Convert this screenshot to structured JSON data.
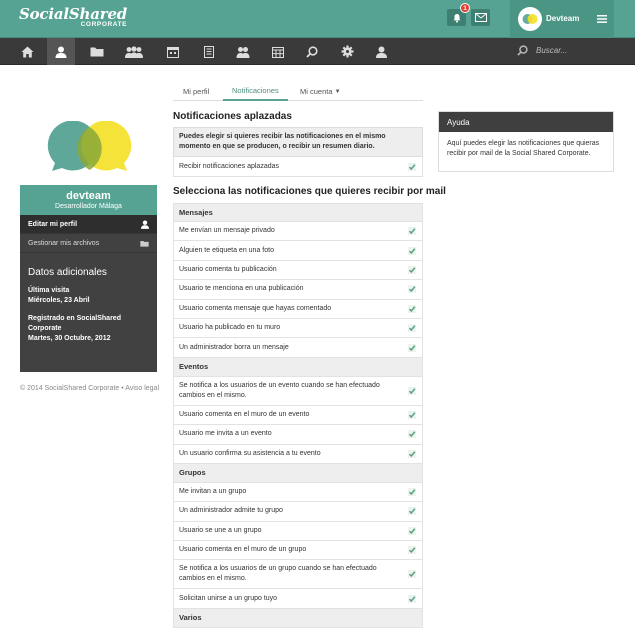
{
  "header": {
    "logo_main": "SocialShared",
    "logo_sub": "CORPORATE",
    "notification_count": "1",
    "user_name": "Devteam"
  },
  "nav": {
    "search_placeholder": "Buscar..."
  },
  "tabs": [
    {
      "label": "Mi perfil"
    },
    {
      "label": "Notificaciones"
    },
    {
      "label": "Mi cuenta"
    }
  ],
  "profile": {
    "name": "devteam",
    "role": "Desarrollador Málaga",
    "menu": [
      {
        "label": "Editar mi perfil"
      },
      {
        "label": "Gestionar mis archivos"
      }
    ],
    "section_title": "Datos adicionales",
    "last_visit_label": "Última visita",
    "last_visit_value": "Miércoles, 23 Abril",
    "registered_label": "Registrado en SocialShared Corporate",
    "registered_value": "Martes, 30 Octubre, 2012"
  },
  "footer": {
    "text": "© 2014 SocialShared Corporate • Aviso legal"
  },
  "deferred": {
    "title": "Notificaciones aplazadas",
    "info": "Puedes elegir si quieres recibir las notificaciones en el mismo momento en que se producen, o recibir un resumen diario.",
    "option": "Recibir notificaciones aplazadas"
  },
  "email": {
    "title": "Selecciona las notificaciones que quieres recibir por mail",
    "rows": [
      {
        "text": "Mensajes",
        "header": true
      },
      {
        "text": "Me envían un mensaje privado"
      },
      {
        "text": "Alguien te etiqueta en una foto"
      },
      {
        "text": "Usuario comenta tu publicación"
      },
      {
        "text": "Usuario te menciona en una publicación"
      },
      {
        "text": "Usuario comenta mensaje que hayas comentado"
      },
      {
        "text": "Usuario ha publicado en tu muro"
      },
      {
        "text": "Un administrador borra un mensaje"
      },
      {
        "text": "Eventos",
        "header": true
      },
      {
        "text": "Se notifica a los usuarios de un evento cuando se han efectuado cambios en el mismo.",
        "tall": true
      },
      {
        "text": "Usuario comenta en el muro de un evento"
      },
      {
        "text": "Usuario me invita a un evento"
      },
      {
        "text": "Un usuario confirma su asistencia a tu evento"
      },
      {
        "text": "Grupos",
        "header": true
      },
      {
        "text": "Me invitan a un grupo"
      },
      {
        "text": "Un administrador admite tu grupo"
      },
      {
        "text": "Usuario se une a un grupo"
      },
      {
        "text": "Usuario comenta en el muro de un grupo"
      },
      {
        "text": "Se notifica a los usuarios de un grupo cuando se han efectuado cambios en el mismo.",
        "tall": true
      },
      {
        "text": "Solicitan unirse a un grupo tuyo"
      },
      {
        "text": "Varios",
        "header": true
      }
    ]
  },
  "help": {
    "title": "Ayuda",
    "text": "Aquí puedes elegir las notificaciones que quieras recibir por mail de la Social Shared Corporate."
  },
  "colors": {
    "brand_green": "#56a393",
    "dark_nav": "#3a3a3a",
    "check_green": "#5aa383"
  }
}
